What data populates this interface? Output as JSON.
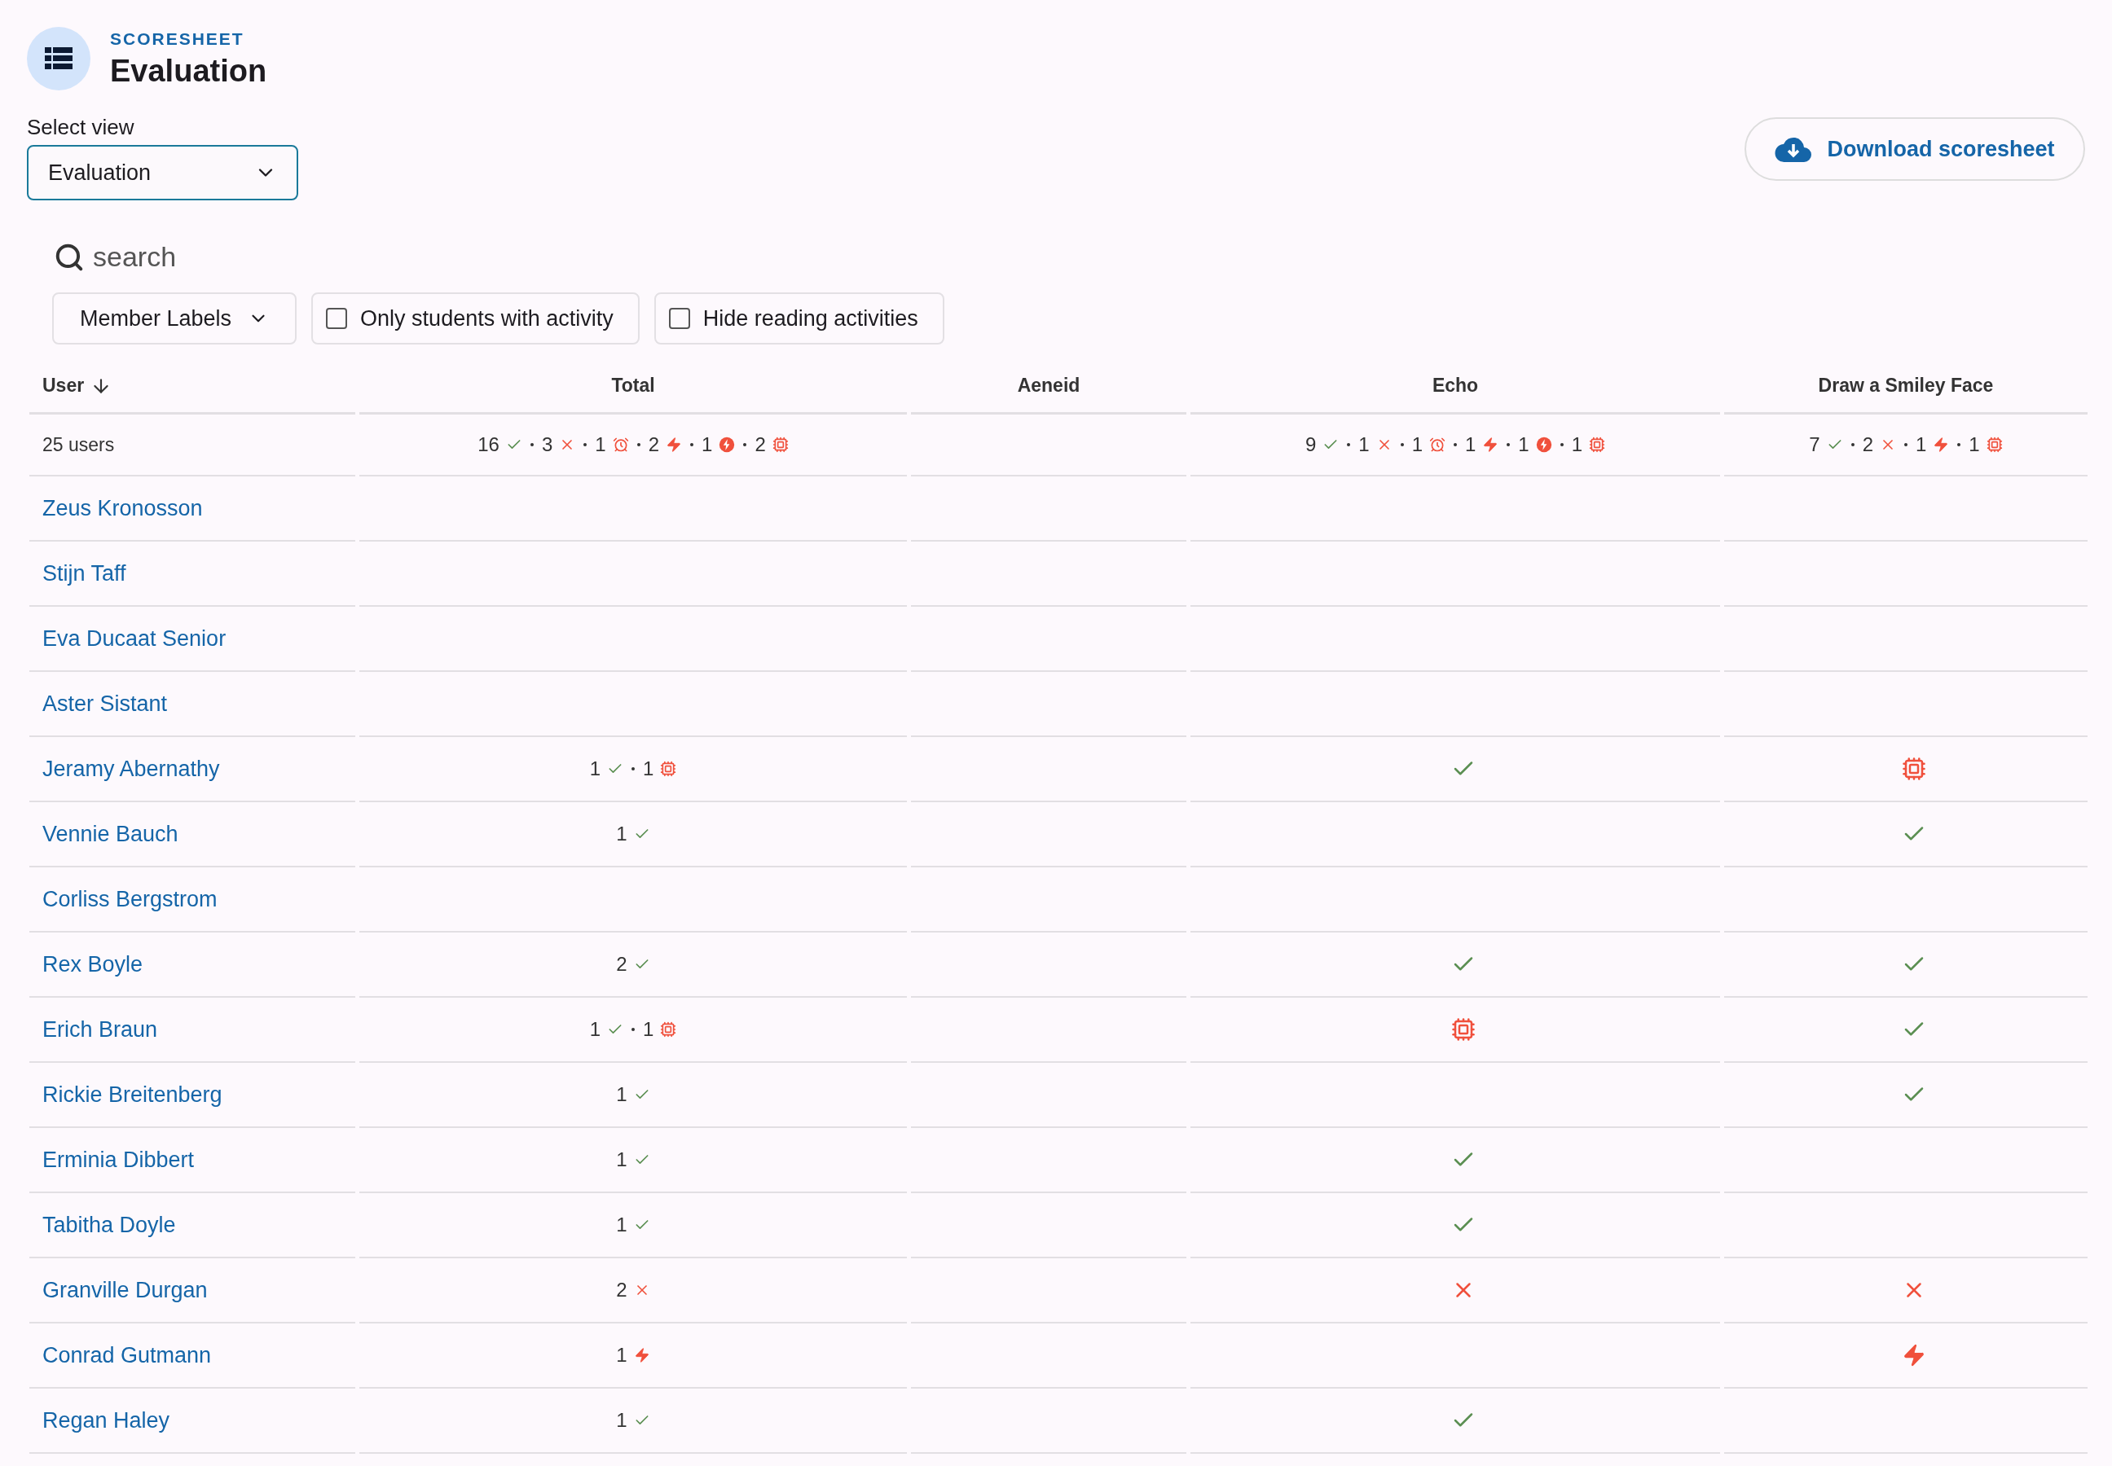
{
  "header": {
    "overline": "SCORESHEET",
    "title": "Evaluation"
  },
  "view_select": {
    "label": "Select view",
    "value": "Evaluation"
  },
  "download_button": {
    "label": "Download scoresheet"
  },
  "search": {
    "placeholder": "search"
  },
  "filters": {
    "labels_dropdown": "Member Labels",
    "checkboxes": [
      {
        "label": "Only students with activity",
        "checked": false
      },
      {
        "label": "Hide reading activities",
        "checked": false
      }
    ]
  },
  "table": {
    "columns": [
      "User",
      "Total",
      "Aeneid",
      "Echo",
      "Draw a Smiley Face"
    ],
    "summary": {
      "user": "25 users",
      "total": [
        {
          "count": "16",
          "kind": "correct"
        },
        {
          "count": "3",
          "kind": "wrong"
        },
        {
          "count": "1",
          "kind": "timeout"
        },
        {
          "count": "2",
          "kind": "runtime"
        },
        {
          "count": "1",
          "kind": "error"
        },
        {
          "count": "2",
          "kind": "memory"
        }
      ],
      "echo": [
        {
          "count": "9",
          "kind": "correct"
        },
        {
          "count": "1",
          "kind": "wrong"
        },
        {
          "count": "1",
          "kind": "timeout"
        },
        {
          "count": "1",
          "kind": "runtime"
        },
        {
          "count": "1",
          "kind": "error"
        },
        {
          "count": "1",
          "kind": "memory"
        }
      ],
      "draw_a_smiley_face": [
        {
          "count": "7",
          "kind": "correct"
        },
        {
          "count": "2",
          "kind": "wrong"
        },
        {
          "count": "1",
          "kind": "runtime"
        },
        {
          "count": "1",
          "kind": "memory"
        }
      ]
    },
    "rows": [
      {
        "user": "Zeus Kronosson"
      },
      {
        "user": "Stijn Taff"
      },
      {
        "user": "Eva Ducaat Senior"
      },
      {
        "user": "Aster Sistant"
      },
      {
        "user": "Jeramy Abernathy",
        "total": [
          {
            "count": "1",
            "kind": "correct"
          },
          {
            "count": "1",
            "kind": "memory"
          }
        ],
        "echo": {
          "kind": "correct"
        },
        "draw_a_smiley_face": {
          "kind": "memory"
        }
      },
      {
        "user": "Vennie Bauch",
        "total": [
          {
            "count": "1",
            "kind": "correct"
          }
        ],
        "draw_a_smiley_face": {
          "kind": "correct"
        }
      },
      {
        "user": "Corliss Bergstrom"
      },
      {
        "user": "Rex Boyle",
        "total": [
          {
            "count": "2",
            "kind": "correct"
          }
        ],
        "echo": {
          "kind": "correct"
        },
        "draw_a_smiley_face": {
          "kind": "correct"
        }
      },
      {
        "user": "Erich Braun",
        "total": [
          {
            "count": "1",
            "kind": "correct"
          },
          {
            "count": "1",
            "kind": "memory"
          }
        ],
        "echo": {
          "kind": "memory"
        },
        "draw_a_smiley_face": {
          "kind": "correct"
        }
      },
      {
        "user": "Rickie Breitenberg",
        "total": [
          {
            "count": "1",
            "kind": "correct"
          }
        ],
        "draw_a_smiley_face": {
          "kind": "correct"
        }
      },
      {
        "user": "Erminia Dibbert",
        "total": [
          {
            "count": "1",
            "kind": "correct"
          }
        ],
        "echo": {
          "kind": "correct"
        }
      },
      {
        "user": "Tabitha Doyle",
        "total": [
          {
            "count": "1",
            "kind": "correct"
          }
        ],
        "echo": {
          "kind": "correct"
        }
      },
      {
        "user": "Granville Durgan",
        "total": [
          {
            "count": "2",
            "kind": "wrong"
          }
        ],
        "echo": {
          "kind": "wrong"
        },
        "draw_a_smiley_face": {
          "kind": "wrong"
        }
      },
      {
        "user": "Conrad Gutmann",
        "total": [
          {
            "count": "1",
            "kind": "runtime"
          }
        ],
        "draw_a_smiley_face": {
          "kind": "runtime"
        }
      },
      {
        "user": "Regan Haley",
        "total": [
          {
            "count": "1",
            "kind": "correct"
          }
        ],
        "echo": {
          "kind": "correct"
        }
      }
    ]
  }
}
